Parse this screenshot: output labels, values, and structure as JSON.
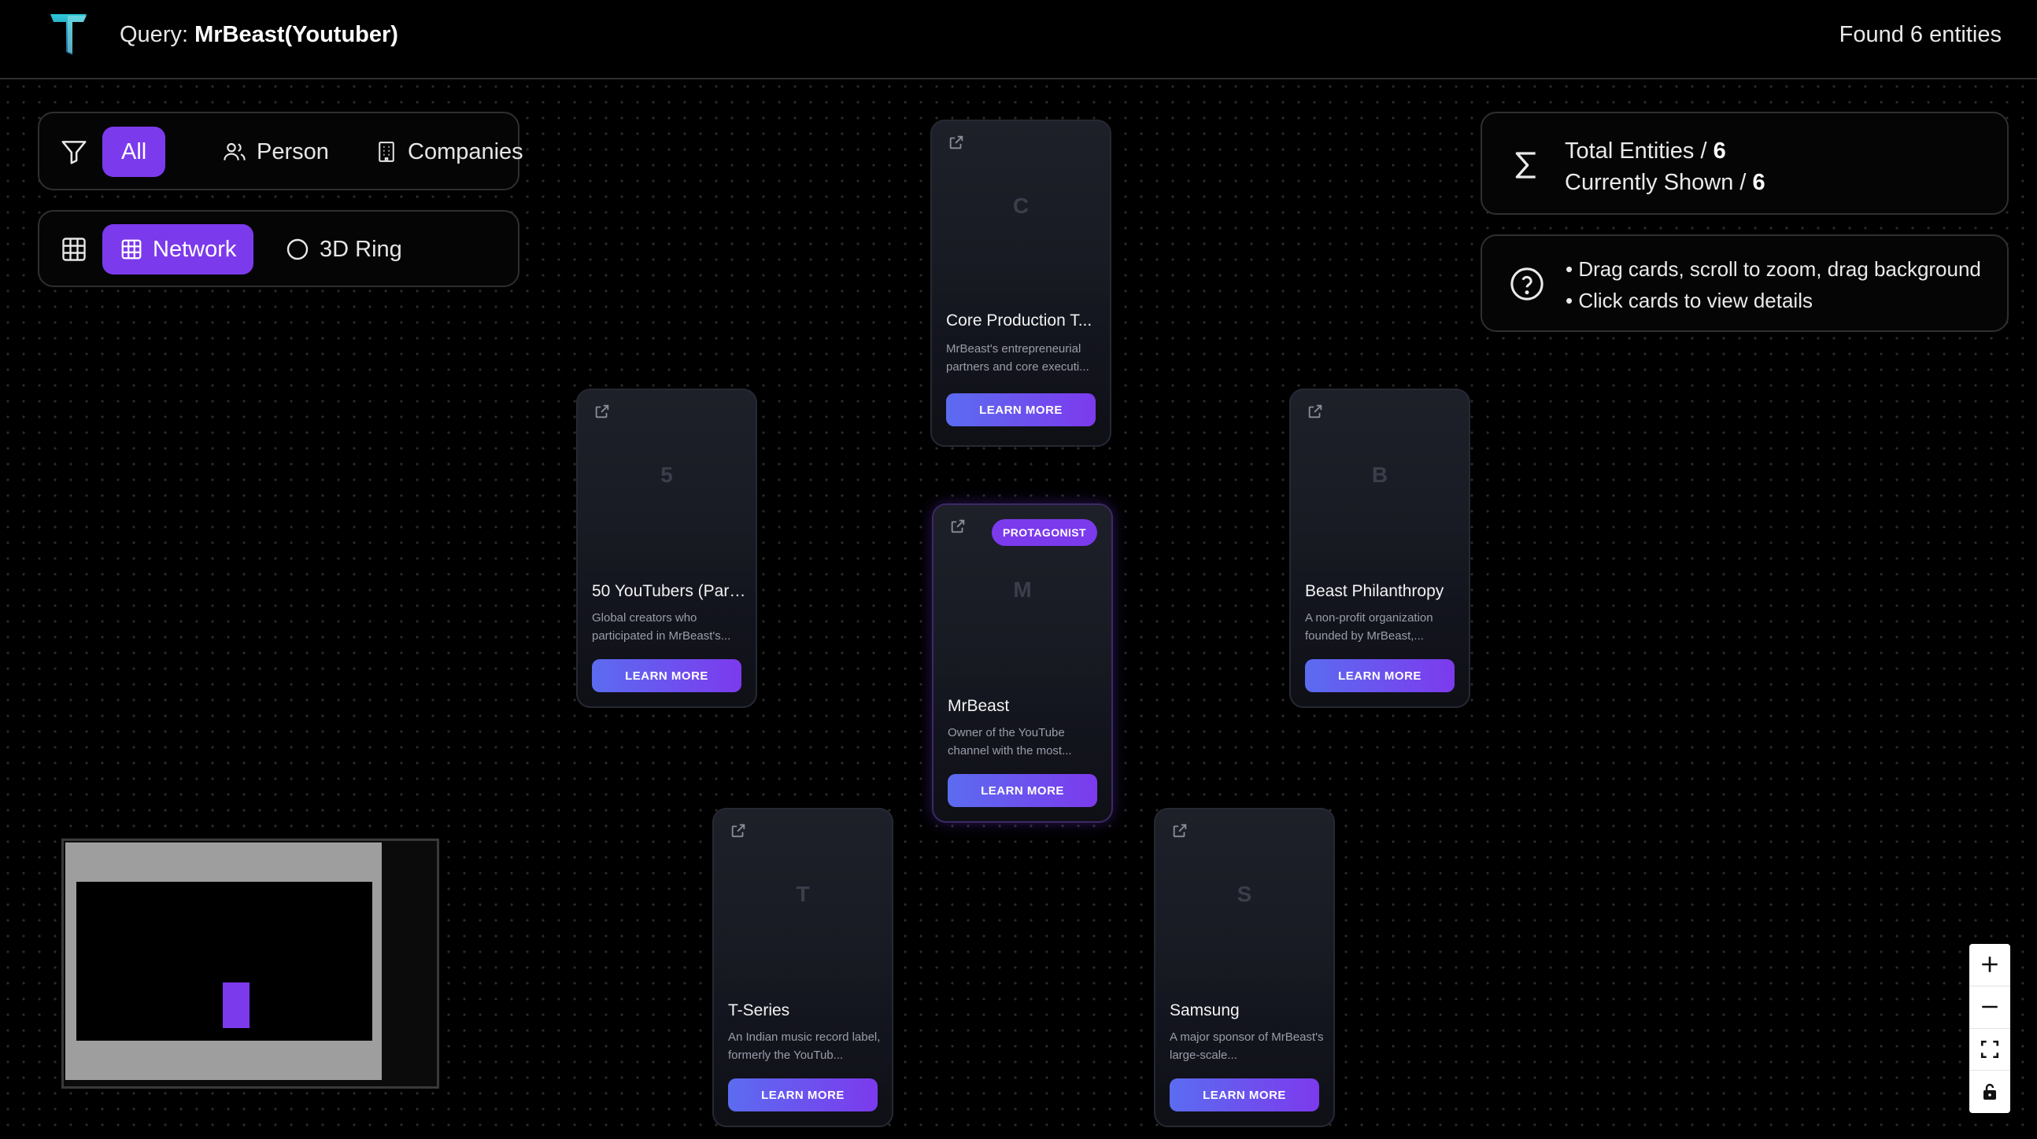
{
  "header": {
    "logo_letter": "T",
    "query_label": "Query:",
    "query_value": "MrBeast(Youtuber)",
    "found_text": "Found 6 entities"
  },
  "filters": {
    "items": [
      {
        "label": "All",
        "icon": "users-all",
        "active": true
      },
      {
        "label": "Person",
        "icon": "users-icon",
        "active": false
      },
      {
        "label": "Companies",
        "icon": "building-icon",
        "active": false
      }
    ]
  },
  "views": {
    "items": [
      {
        "label": "Network",
        "icon": "grid-icon",
        "active": true
      },
      {
        "label": "3D Ring",
        "icon": "circle-icon",
        "active": false
      }
    ]
  },
  "stats": {
    "total_label": "Total Entities / ",
    "total_value": "6",
    "shown_label": "Currently Shown / ",
    "shown_value": "6"
  },
  "help": {
    "line1": "• Drag cards, scroll to zoom, drag background",
    "line2": "• Click cards to view details"
  },
  "cards": {
    "core": {
      "letter": "C",
      "title": "Core Production T...",
      "desc": "MrBeast's entrepreneurial partners and core executi...",
      "button": "LEARN MORE"
    },
    "youtubers": {
      "letter": "5",
      "title": "50 YouTubers (Part...",
      "desc": "Global creators who participated in MrBeast's...",
      "button": "LEARN MORE"
    },
    "mrbeast": {
      "letter": "M",
      "title": "MrBeast",
      "desc": "Owner of the YouTube channel with the most...",
      "button": "LEARN MORE",
      "badge": "PROTAGONIST"
    },
    "philanthropy": {
      "letter": "B",
      "title": "Beast Philanthropy",
      "desc": "A non-profit organization founded by MrBeast,...",
      "button": "LEARN MORE"
    },
    "tseries": {
      "letter": "T",
      "title": "T-Series",
      "desc": "An Indian music record label, formerly the YouTub...",
      "button": "LEARN MORE"
    },
    "samsung": {
      "letter": "S",
      "title": "Samsung",
      "desc": "A major sponsor of MrBeast's large-scale...",
      "button": "LEARN MORE"
    }
  },
  "controls": [
    "zoom-in-icon",
    "zoom-out-icon",
    "fit-view-icon",
    "lock-icon"
  ],
  "colors": {
    "accent": "#7c3aed",
    "button_gradient_start": "#5b6cf0",
    "background": "#000000"
  }
}
